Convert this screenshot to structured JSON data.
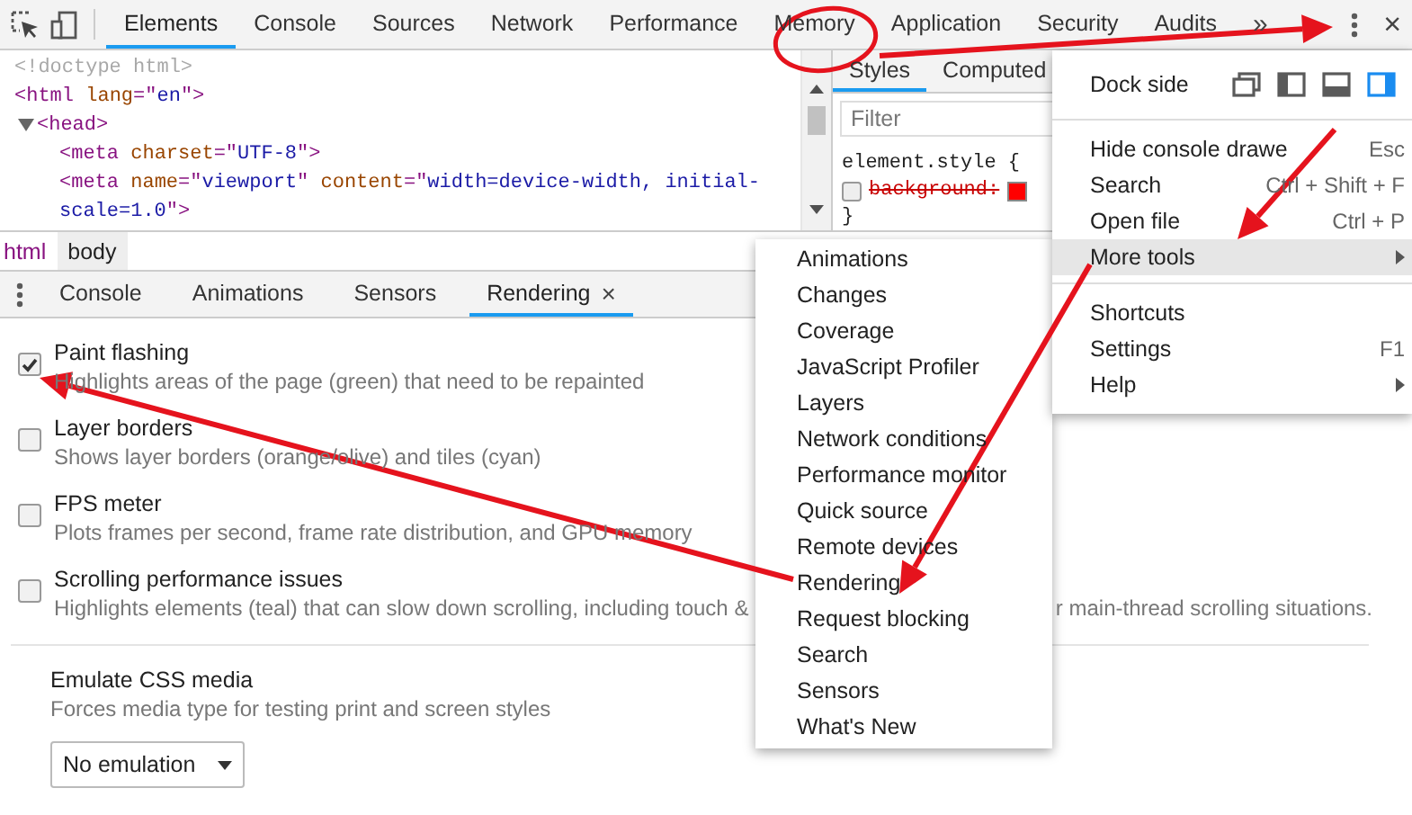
{
  "toolbar": {
    "tabs": [
      {
        "label": "Elements",
        "selected": true
      },
      {
        "label": "Console",
        "selected": false
      },
      {
        "label": "Sources",
        "selected": false
      },
      {
        "label": "Network",
        "selected": false
      },
      {
        "label": "Performance",
        "selected": false
      },
      {
        "label": "Memory",
        "selected": false
      },
      {
        "label": "Application",
        "selected": false
      },
      {
        "label": "Security",
        "selected": false
      },
      {
        "label": "Audits",
        "selected": false
      }
    ],
    "overflow": "»",
    "close": "×"
  },
  "elements": {
    "nodes": [
      {
        "tokens": [
          {
            "t": "<!doctype html>",
            "kind": "doctype"
          }
        ]
      },
      {
        "tokens": [
          {
            "t": "<html",
            "kind": "tag"
          },
          {
            "t": " lang",
            "kind": "attr"
          },
          {
            "t": "=\"",
            "kind": "tag"
          },
          {
            "t": "en",
            "kind": "value"
          },
          {
            "t": "\">",
            "kind": "tag"
          }
        ],
        "children": [
          {
            "tokens": [
              {
                "t": "<head>",
                "kind": "tag"
              }
            ],
            "expanded": true,
            "children": [
              {
                "tokens": [
                  {
                    "t": "<meta",
                    "kind": "tag"
                  },
                  {
                    "t": " charset",
                    "kind": "attr"
                  },
                  {
                    "t": "=\"",
                    "kind": "tag"
                  },
                  {
                    "t": "UTF-8",
                    "kind": "value"
                  },
                  {
                    "t": "\">",
                    "kind": "tag"
                  }
                ]
              },
              {
                "tokens": [
                  {
                    "t": "<meta",
                    "kind": "tag"
                  },
                  {
                    "t": " name",
                    "kind": "attr"
                  },
                  {
                    "t": "=\"",
                    "kind": "tag"
                  },
                  {
                    "t": "viewport",
                    "kind": "value"
                  },
                  {
                    "t": "\"",
                    "kind": "tag"
                  },
                  {
                    "t": " content",
                    "kind": "attr"
                  },
                  {
                    "t": "=\"",
                    "kind": "tag"
                  },
                  {
                    "t": "width=device-width, initial-scale=1.0",
                    "kind": "value"
                  },
                  {
                    "t": "\">",
                    "kind": "tag"
                  }
                ]
              }
            ]
          }
        ]
      }
    ]
  },
  "styles": {
    "tabs": [
      {
        "label": "Styles",
        "selected": true
      },
      {
        "label": "Computed",
        "selected": false
      }
    ],
    "filter": {
      "placeholder": "Filter"
    },
    "rule": {
      "selector": "element.style",
      "open": "{",
      "close": "}",
      "declarations": [
        {
          "property": "background:",
          "enabled": false,
          "color": "#ff0000"
        }
      ]
    }
  },
  "breadcrumbs": [
    {
      "label": "html",
      "selected": false
    },
    {
      "label": "body",
      "selected": true
    }
  ],
  "drawer": {
    "tabs": [
      {
        "label": "Console",
        "selected": false
      },
      {
        "label": "Animations",
        "selected": false
      },
      {
        "label": "Sensors",
        "selected": false
      },
      {
        "label": "Rendering",
        "selected": true,
        "close": "×"
      }
    ]
  },
  "rendering": [
    {
      "kind": "checkbox",
      "title": "Paint flashing",
      "description": "Highlights areas of the page (green) that need to be repainted",
      "checked": true
    },
    {
      "kind": "checkbox",
      "title": "Layer borders",
      "description": "Shows layer borders (orange/olive) and tiles (cyan)",
      "checked": false
    },
    {
      "kind": "checkbox",
      "title": "FPS meter",
      "description": "Plots frames per second, frame rate distribution, and GPU memory",
      "checked": false
    },
    {
      "kind": "checkbox",
      "title": "Scrolling performance issues",
      "description": "Highlights elements (teal) that can slow down scrolling, including touch &",
      "description_tail": "r main-thread scrolling situations.",
      "checked": false
    },
    {
      "kind": "select",
      "title": "Emulate CSS media",
      "description": "Forces media type for testing print and screen styles",
      "value": "No emulation"
    }
  ],
  "menu": {
    "dock_label": "Dock side",
    "dock_options": [
      {
        "selected": false
      },
      {
        "selected": false
      },
      {
        "selected": false
      },
      {
        "selected": true
      }
    ],
    "groups": [
      [
        {
          "label": "Hide console drawe",
          "shortcut": "Esc",
          "selected": false,
          "submenu": false
        },
        {
          "label": "Search",
          "shortcut": "Ctrl + Shift + F",
          "selected": false,
          "submenu": false
        },
        {
          "label": "Open file",
          "shortcut": "Ctrl + P",
          "selected": false,
          "submenu": false
        },
        {
          "label": "More tools",
          "selected": true,
          "submenu": true
        }
      ],
      [
        {
          "label": "Shortcuts",
          "selected": false,
          "submenu": false
        },
        {
          "label": "Settings",
          "shortcut": "F1",
          "selected": false,
          "submenu": false
        },
        {
          "label": "Help",
          "selected": false,
          "submenu": true
        }
      ]
    ]
  },
  "submenu": {
    "items": [
      {
        "label": "Animations",
        "selected": false
      },
      {
        "label": "Changes",
        "selected": false
      },
      {
        "label": "Coverage",
        "selected": false
      },
      {
        "label": "JavaScript Profiler",
        "selected": false
      },
      {
        "label": "Layers",
        "selected": false
      },
      {
        "label": "Network conditions",
        "selected": false
      },
      {
        "label": "Performance monitor",
        "selected": false
      },
      {
        "label": "Quick source",
        "selected": false
      },
      {
        "label": "Remote devices",
        "selected": false
      },
      {
        "label": "Rendering",
        "selected": false
      },
      {
        "label": "Request blocking",
        "selected": false
      },
      {
        "label": "Search",
        "selected": false
      },
      {
        "label": "Sensors",
        "selected": false
      },
      {
        "label": "What's New",
        "selected": false
      }
    ]
  },
  "annotations": [
    {
      "kind": "circle"
    },
    {
      "kind": "arrow"
    },
    {
      "kind": "arrow"
    },
    {
      "kind": "arrow"
    },
    {
      "kind": "arrow"
    }
  ]
}
